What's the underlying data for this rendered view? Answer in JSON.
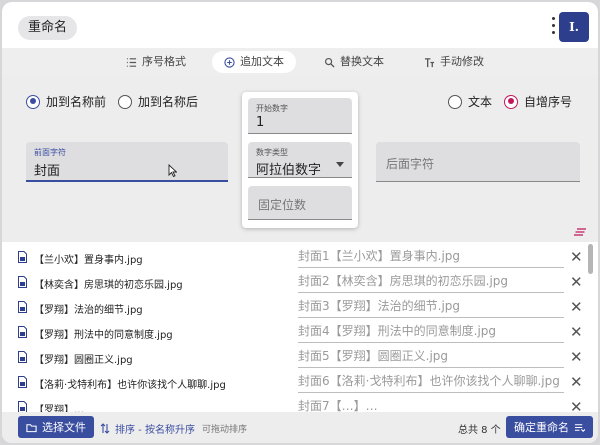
{
  "header": {
    "title": "重命名",
    "avatar_text": "I.",
    "accent": "#3a4ea0"
  },
  "tabs": [
    {
      "label": "序号格式",
      "icon": "list-icon"
    },
    {
      "label": "追加文本",
      "icon": "add-circle-icon",
      "active": true
    },
    {
      "label": "替换文本",
      "icon": "search-replace-icon"
    },
    {
      "label": "手动修改",
      "icon": "text-edit-icon"
    }
  ],
  "options": {
    "position_prepend": "加到名称前",
    "position_append": "加到名称后",
    "mode_text": "文本",
    "mode_sequence": "自增序号",
    "selected_position": "加到名称前",
    "selected_mode": "自增序号"
  },
  "prefix": {
    "label": "前面字符",
    "value": "封面"
  },
  "suffix": {
    "placeholder": "后面字符"
  },
  "sequence": {
    "start_label": "开始数字",
    "start_value": "1",
    "type_label": "数字类型",
    "type_value": "阿拉伯数字",
    "fixed_digits_placeholder": "固定位数"
  },
  "files": [
    {
      "source": "【兰小欢】置身事内.jpg",
      "target": "封面1【兰小欢】置身事内.jpg"
    },
    {
      "source": "【林奕含】房思琪的初恋乐园.jpg",
      "target": "封面2【林奕含】房思琪的初恋乐园.jpg"
    },
    {
      "source": "【罗翔】法治的细节.jpg",
      "target": "封面3【罗翔】法治的细节.jpg"
    },
    {
      "source": "【罗翔】刑法中的同意制度.jpg",
      "target": "封面4【罗翔】刑法中的同意制度.jpg"
    },
    {
      "source": "【罗翔】圆圈正义.jpg",
      "target": "封面5【罗翔】圆圈正义.jpg"
    },
    {
      "source": "【洛莉·戈特利布】也许你该找个人聊聊.jpg",
      "target": "封面6【洛莉·戈特利布】也许你该找个人聊聊.jpg"
    },
    {
      "source": "【罗翔】…",
      "target": "封面7【…】…"
    }
  ],
  "footer": {
    "select_files": "选择文件",
    "sort_label": "排序 - 按名称升序",
    "drag_hint": "可拖动排序",
    "total": "总共 8 个",
    "confirm": "确定重命名"
  }
}
